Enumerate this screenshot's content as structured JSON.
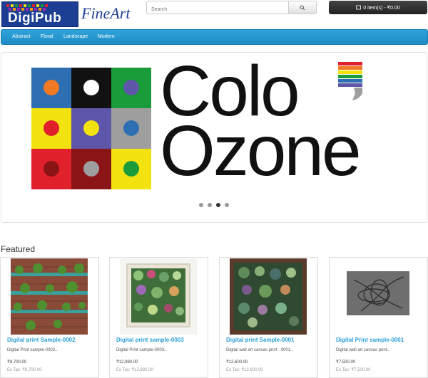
{
  "header": {
    "logo_text": "DigiPub",
    "logo_subtitle": "FineArt",
    "search_placeholder": "Search",
    "cart_label": "0 item(s) - ₹0.00"
  },
  "nav": {
    "items": [
      {
        "label": "Abstract"
      },
      {
        "label": "Floral"
      },
      {
        "label": "Landscape"
      },
      {
        "label": "Modern"
      }
    ]
  },
  "banner": {
    "line1": "Colo",
    "line2": "Ozone",
    "grid_colors": [
      [
        "#2e6eb3",
        "#111111",
        "#1a9c3a"
      ],
      [
        "#f2e20f",
        "#5e56a8",
        "#9e9e9e"
      ],
      [
        "#e0202a",
        "#8a1416",
        "#f2e20f"
      ]
    ],
    "dot_colors": [
      [
        "#f07a24",
        "#ffffff",
        "#5e56a8"
      ],
      [
        "#e0202a",
        "#f2e20f",
        "#2e6eb3"
      ],
      [
        "#8a1416",
        "#9e9e9e",
        "#1a9c3a"
      ]
    ],
    "slides": 4,
    "active_slide": 3
  },
  "featured": {
    "title": "Featured",
    "products": [
      {
        "name": "Digital print Sample-0002",
        "desc": "Digital Print sample-0002..",
        "price": "₹8,700.00",
        "ex_tax": "Ex Tax: ₹8,700.00"
      },
      {
        "name": "Digital print sample-0003",
        "desc": "Digital Print sample-0003..",
        "price": "₹12,980.00",
        "ex_tax": "Ex Tax: ₹12,980.00"
      },
      {
        "name": "Digital print Sample-0001",
        "desc": "Digital wall art canvas print - 0001..",
        "price": "₹12,600.00",
        "ex_tax": "Ex Tax: ₹12,600.00"
      },
      {
        "name": "Digital Print sample-0001",
        "desc": "Digital wall art canvas print..",
        "price": "₹7,500.00",
        "ex_tax": "Ex Tax: ₹7,500.00"
      }
    ]
  },
  "colors": {
    "nav": "#2fa4da",
    "product_title": "#2a9fd6",
    "brand": "#1d3f93"
  }
}
